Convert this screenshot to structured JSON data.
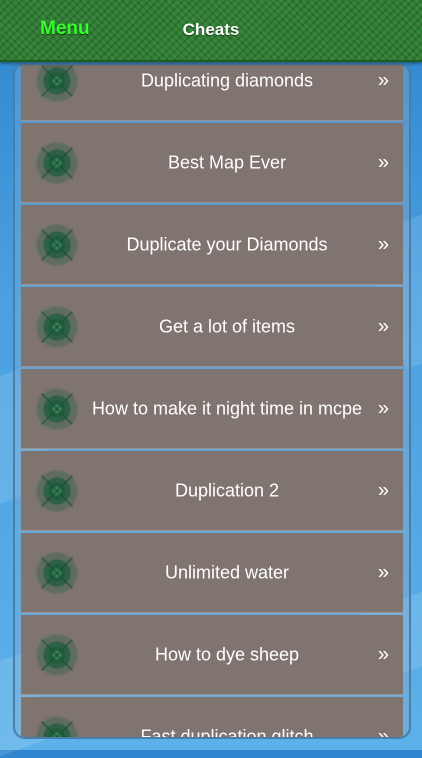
{
  "nav": {
    "menu_label": "Menu",
    "title": "Cheats"
  },
  "list": {
    "chevron": "»",
    "icon": "green-starburst-icon",
    "items": [
      {
        "label": "Duplicating diamonds"
      },
      {
        "label": "Best Map Ever"
      },
      {
        "label": "Duplicate your Diamonds"
      },
      {
        "label": "Get a lot of items"
      },
      {
        "label": "How to make it night time in mcpe"
      },
      {
        "label": "Duplication 2"
      },
      {
        "label": "Unlimited water"
      },
      {
        "label": "How to dye sheep"
      },
      {
        "label": "Fast duplication glitch"
      }
    ]
  },
  "colors": {
    "nav_green": "#2e7d32",
    "menu_text": "#36ff2c",
    "row_bg": "#7f7470",
    "background_blue": "#4aa0e0"
  }
}
